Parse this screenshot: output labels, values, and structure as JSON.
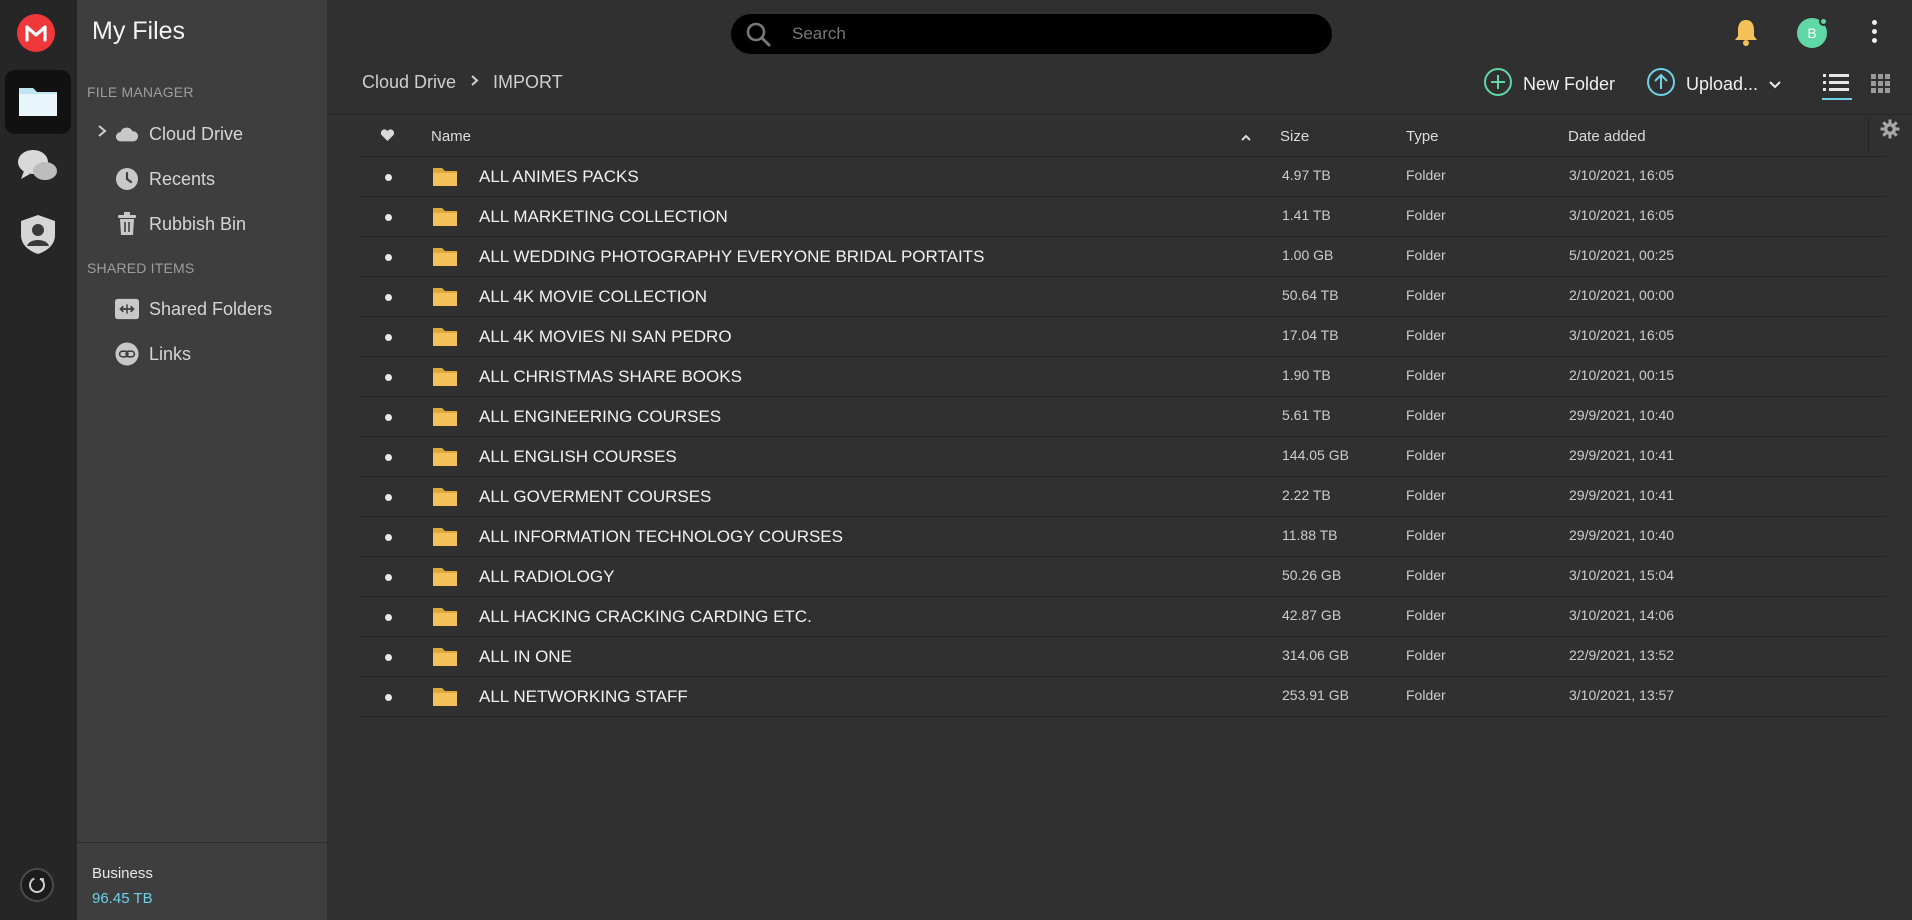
{
  "sidebar": {
    "title": "My Files",
    "file_manager_label": "FILE MANAGER",
    "shared_items_label": "SHARED ITEMS",
    "items": [
      {
        "label": "Cloud Drive",
        "icon": "cloud-icon"
      },
      {
        "label": "Recents",
        "icon": "clock-icon"
      },
      {
        "label": "Rubbish Bin",
        "icon": "trash-icon"
      },
      {
        "label": "Shared Folders",
        "icon": "shared-folder-icon"
      },
      {
        "label": "Links",
        "icon": "link-icon"
      }
    ],
    "storage": {
      "plan": "Business",
      "amount": "96.45 TB"
    }
  },
  "search": {
    "placeholder": "Search",
    "value": ""
  },
  "user": {
    "initial": "B"
  },
  "breadcrumb": {
    "root": "Cloud Drive",
    "current": "IMPORT"
  },
  "toolbar": {
    "new_folder_label": "New Folder",
    "upload_label": "Upload..."
  },
  "table": {
    "headers": {
      "name": "Name",
      "size": "Size",
      "type": "Type",
      "date": "Date added"
    },
    "rows": [
      {
        "name": "ALL ANIMES PACKS",
        "size": "4.97 TB",
        "type": "Folder",
        "date": "3/10/2021, 16:05"
      },
      {
        "name": "ALL MARKETING COLLECTION",
        "size": "1.41 TB",
        "type": "Folder",
        "date": "3/10/2021, 16:05"
      },
      {
        "name": "ALL WEDDING PHOTOGRAPHY EVERYONE BRIDAL PORTAITS",
        "size": "1.00 GB",
        "type": "Folder",
        "date": "5/10/2021, 00:25"
      },
      {
        "name": "ALL 4K MOVIE COLLECTION",
        "size": "50.64 TB",
        "type": "Folder",
        "date": "2/10/2021, 00:00"
      },
      {
        "name": "ALL 4K MOVIES NI SAN PEDRO",
        "size": "17.04 TB",
        "type": "Folder",
        "date": "3/10/2021, 16:05"
      },
      {
        "name": "ALL CHRISTMAS SHARE BOOKS",
        "size": "1.90 TB",
        "type": "Folder",
        "date": "2/10/2021, 00:15"
      },
      {
        "name": "ALL ENGINEERING COURSES",
        "size": "5.61 TB",
        "type": "Folder",
        "date": "29/9/2021, 10:40"
      },
      {
        "name": "ALL ENGLISH COURSES",
        "size": "144.05 GB",
        "type": "Folder",
        "date": "29/9/2021, 10:41"
      },
      {
        "name": "ALL GOVERMENT COURSES",
        "size": "2.22 TB",
        "type": "Folder",
        "date": "29/9/2021, 10:41"
      },
      {
        "name": "ALL INFORMATION TECHNOLOGY COURSES",
        "size": "11.88 TB",
        "type": "Folder",
        "date": "29/9/2021, 10:40"
      },
      {
        "name": "ALL RADIOLOGY",
        "size": "50.26 GB",
        "type": "Folder",
        "date": "3/10/2021, 15:04"
      },
      {
        "name": "ALL HACKING CRACKING CARDING ETC.",
        "size": "42.87 GB",
        "type": "Folder",
        "date": "3/10/2021, 14:06"
      },
      {
        "name": "ALL IN ONE",
        "size": "314.06 GB",
        "type": "Folder",
        "date": "22/9/2021, 13:52"
      },
      {
        "name": "ALL NETWORKING STAFF",
        "size": "253.91 GB",
        "type": "Folder",
        "date": "3/10/2021, 13:57"
      }
    ]
  },
  "colors": {
    "brand": "#f0373a",
    "accent": "#6fd0e8",
    "avatar": "#5fd8a6",
    "folder": "#f5c15a"
  }
}
